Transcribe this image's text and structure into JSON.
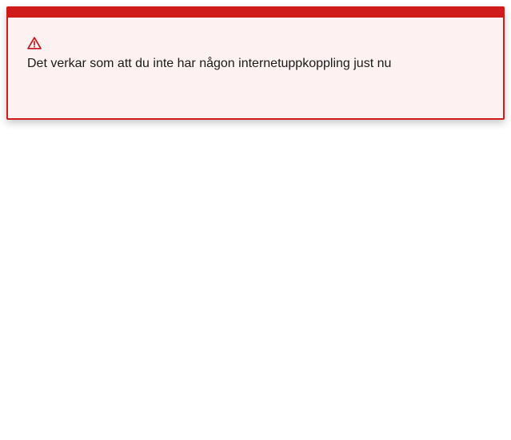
{
  "alert": {
    "icon": "warning-triangle-icon",
    "message": "Det verkar som att du inte har någon internetuppkoppling just nu",
    "accent_color": "#d01b1b",
    "background_color": "#fdf2f1"
  }
}
